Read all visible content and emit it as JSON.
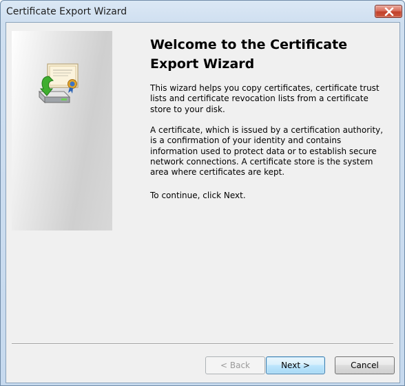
{
  "window": {
    "title": "Certificate Export Wizard"
  },
  "main": {
    "heading": "Welcome to the Certificate Export Wizard",
    "paragraph1": "This wizard helps you copy certificates, certificate trust lists and certificate revocation lists from a certificate store to your disk.",
    "paragraph2": "A certificate, which is issued by a certification authority, is a confirmation of your identity and contains information used to protect data or to establish secure network connections. A certificate store is the system area where certificates are kept.",
    "paragraph3": "To continue, click Next."
  },
  "buttons": {
    "back_label": "< Back",
    "next_label": "Next >",
    "cancel_label": "Cancel",
    "back_enabled": false
  },
  "icons": {
    "titlebar_close": "close-icon",
    "wizard_graphic": "certificate-export-icon"
  },
  "colors": {
    "titlebar": "#cfdff0",
    "close_button": "#c1402b",
    "client_background": "#f0f0f0",
    "default_button_border": "#3c7fb1"
  }
}
